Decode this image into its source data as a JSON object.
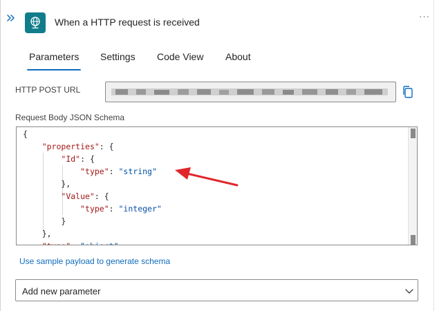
{
  "header": {
    "title": "When a HTTP request is received",
    "more_label": "···",
    "icon": "globe-icon"
  },
  "tabs": [
    {
      "label": "Parameters",
      "active": true
    },
    {
      "label": "Settings",
      "active": false
    },
    {
      "label": "Code View",
      "active": false
    },
    {
      "label": "About",
      "active": false
    }
  ],
  "parameters": {
    "http_post_url_label": "HTTP POST URL",
    "http_post_url_value": "",
    "schema_label": "Request Body JSON Schema",
    "schema_lines": [
      "{",
      "    \"properties\": {",
      "        \"Id\": {",
      "            \"type\": \"string\"",
      "        },",
      "        \"Value\": {",
      "            \"type\": \"integer\"",
      "        }",
      "    },",
      "    \"type\": \"object\""
    ],
    "sample_link": "Use sample payload to generate schema",
    "add_param_placeholder": "Add new parameter"
  },
  "colors": {
    "accent": "#0f6cbd",
    "trigger_icon_bg": "#117d8b",
    "annotation_arrow": "#e0262b",
    "json_key": "#a31515",
    "json_string": "#0451a5"
  }
}
